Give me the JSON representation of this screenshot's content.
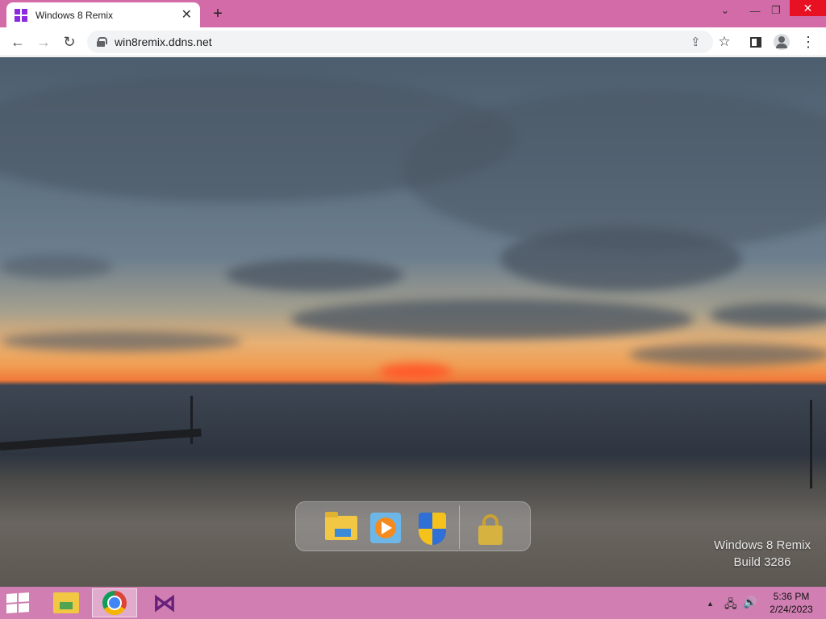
{
  "browser": {
    "tab_title": "Windows 8 Remix",
    "tab_close": "✕",
    "new_tab": "+",
    "window_controls": {
      "tab_search": "⌄",
      "minimize": "—",
      "restore": "❐",
      "close": "✕"
    },
    "nav": {
      "back": "←",
      "forward": "→",
      "reload": "↻"
    },
    "url": "win8remix.ddns.net",
    "icons": [
      "share-icon",
      "star-icon",
      "side-panel-icon",
      "profile-icon",
      "menu-icon"
    ]
  },
  "desktop": {
    "wallpaper": "sunset-over-sea",
    "dock": {
      "items": [
        "file-explorer-icon",
        "media-player-icon",
        "security-shield-icon",
        "lock-icon"
      ]
    },
    "watermark": {
      "line1": "Windows 8 Remix",
      "line2": "Build 3286"
    }
  },
  "taskbar": {
    "start_icon": "windows-logo-icon",
    "apps": [
      "file-explorer",
      "google-chrome",
      "visual-studio"
    ],
    "active_app": "google-chrome",
    "tray": {
      "chevron": "▲",
      "network": "network-icon",
      "volume": "volume-icon"
    },
    "time": "5:36 PM",
    "date": "2/24/2023"
  },
  "colors": {
    "titlebar": "#d36ba8",
    "taskbar": "#d17fb2",
    "close": "#e81123"
  }
}
